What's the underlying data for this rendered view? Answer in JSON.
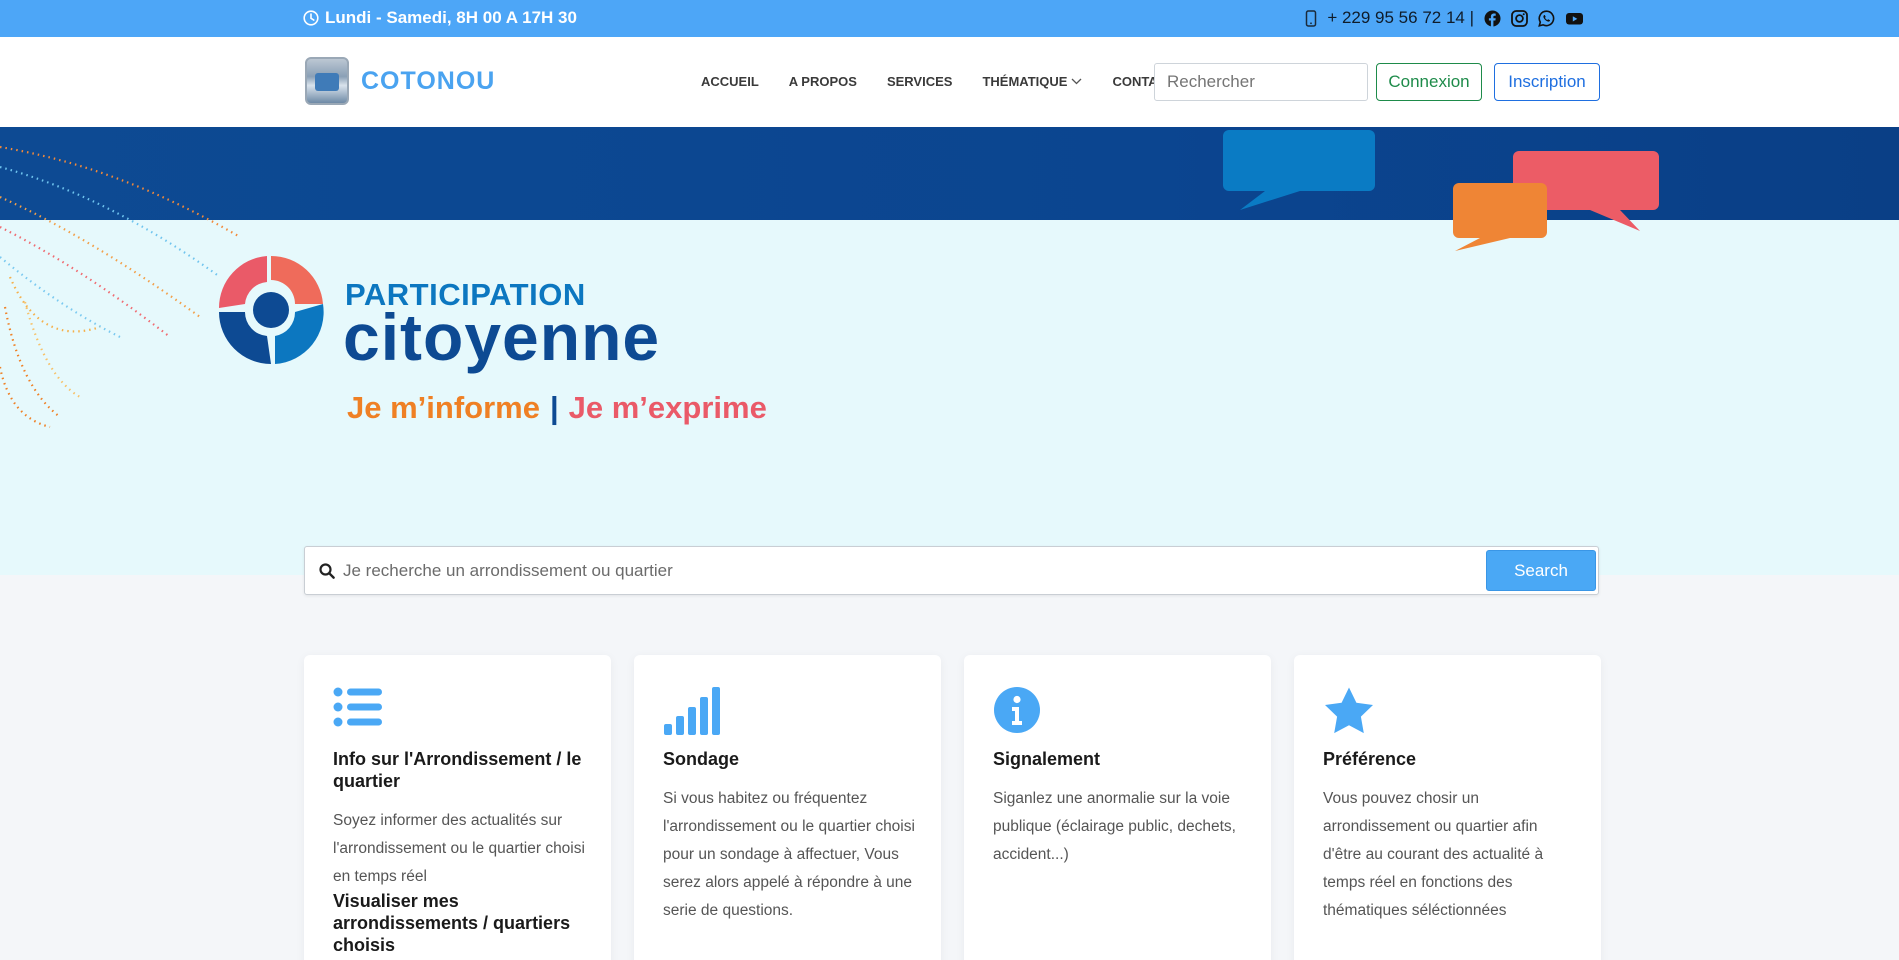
{
  "topbar": {
    "hours": "Lundi - Samedi, 8H 00 A 17H 30",
    "phone": "+ 229 95 56 72 14 |",
    "social": [
      "facebook-icon",
      "instagram-icon",
      "whatsapp-icon",
      "youtube-icon"
    ]
  },
  "navbar": {
    "brand": "COTONOU",
    "links": [
      "ACCUEIL",
      "A PROPOS",
      "SERVICES",
      "THÉMATIQUE",
      "CONTACT"
    ],
    "search_placeholder": "Rechercher",
    "login": "Connexion",
    "register": "Inscription"
  },
  "hero": {
    "title_small": "PARTICIPATION",
    "title_big": "citoyenne",
    "tagline_a": "Je m’informe",
    "tagline_sep": "|",
    "tagline_b": "Je m’exprime"
  },
  "search": {
    "placeholder": "Je recherche un arrondissement ou quartier",
    "button": "Search"
  },
  "cards": [
    {
      "icon": "list-icon",
      "title": "Info sur l'Arrondissement / le quartier",
      "text": "Soyez informer des actualités sur l'arrondissement ou le quartier choisi en temps réel",
      "subtitle": "Visualiser mes arrondissements / quartiers choisis"
    },
    {
      "icon": "signal-bars-icon",
      "title": "Sondage",
      "text": "Si vous habitez ou fréquentez l'arrondissement ou le quartier choisi pour un sondage à affectuer, Vous serez alors appelé à répondre à une serie de questions."
    },
    {
      "icon": "info-circle-icon",
      "title": "Signalement",
      "text": "Siganlez une anormalie sur la voie publique (éclairage public, dechets, accident...)"
    },
    {
      "icon": "star-icon",
      "title": "Préférence",
      "text": "Vous pouvez chosir un arrondissement ou quartier afin d'être au courant des actualité à temps réel en fonctions des thématiques séléctionnées"
    }
  ],
  "colors": {
    "topbar": "#4da6f7",
    "brand": "#4aa3f0",
    "hero_bg": "#e6f9fc",
    "hero_band": "#0d4a93",
    "accent_orange": "#ef8024",
    "accent_red": "#ea5a68",
    "icon_blue": "#4aa8f5"
  }
}
